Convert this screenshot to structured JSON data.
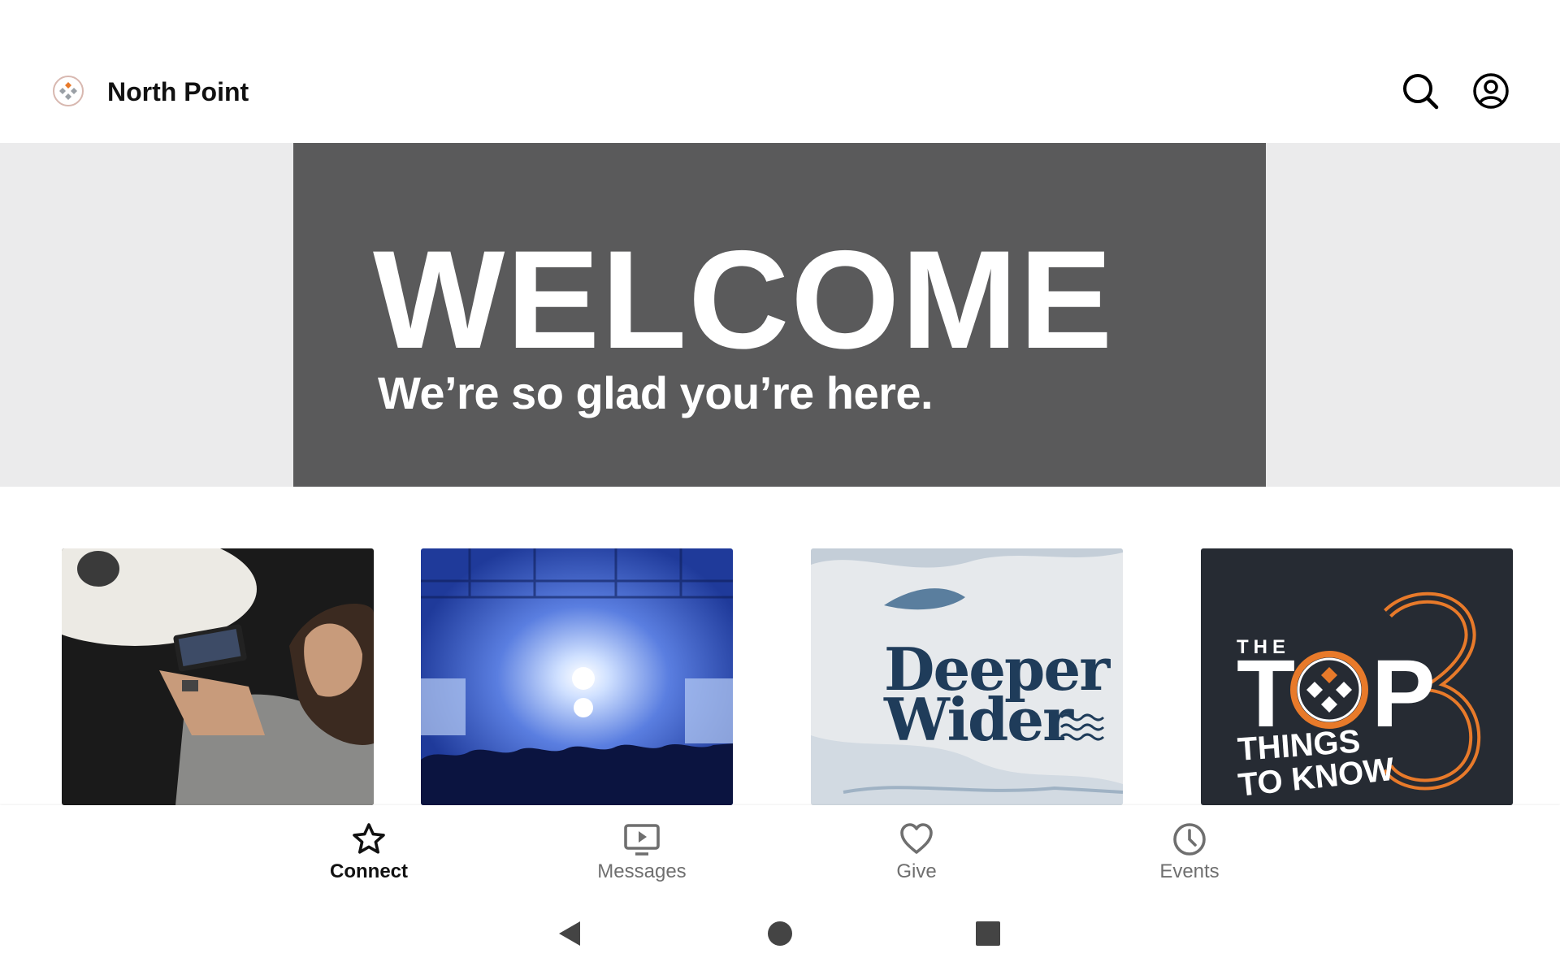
{
  "header": {
    "title": "North Point",
    "logo_icon": "north-point-logo",
    "search_icon": "search-icon",
    "account_icon": "account-circle-icon"
  },
  "hero": {
    "headline": "WELCOME",
    "subtext": "We’re so glad you’re here.",
    "background": "#5a5a5b"
  },
  "tiles": [
    {
      "image": "person-filming-with-phone"
    },
    {
      "image": "concert-stage-lights"
    },
    {
      "image": "deeper-wider-artwork",
      "title_line1": "Deeper",
      "title_line2": "Wider"
    },
    {
      "image": "top-3-things-to-know-artwork",
      "the": "THE",
      "top": "T",
      "top_p": "P",
      "line2": "THINGS",
      "line3": "TO KNOW"
    }
  ],
  "bottom_nav": {
    "items": [
      {
        "label": "Connect",
        "icon": "star-icon",
        "active": true
      },
      {
        "label": "Messages",
        "icon": "video-play-icon",
        "active": false
      },
      {
        "label": "Give",
        "icon": "heart-icon",
        "active": false
      },
      {
        "label": "Events",
        "icon": "clock-icon",
        "active": false
      }
    ]
  },
  "system_nav": {
    "back": "back-triangle-icon",
    "home": "home-circle-icon",
    "recents": "recents-square-icon"
  },
  "colors": {
    "accent_orange": "#e87a2a",
    "deeper_wider_blue": "#1f3c5a",
    "active_nav": "#111111",
    "inactive_nav": "#6f6f6f"
  }
}
